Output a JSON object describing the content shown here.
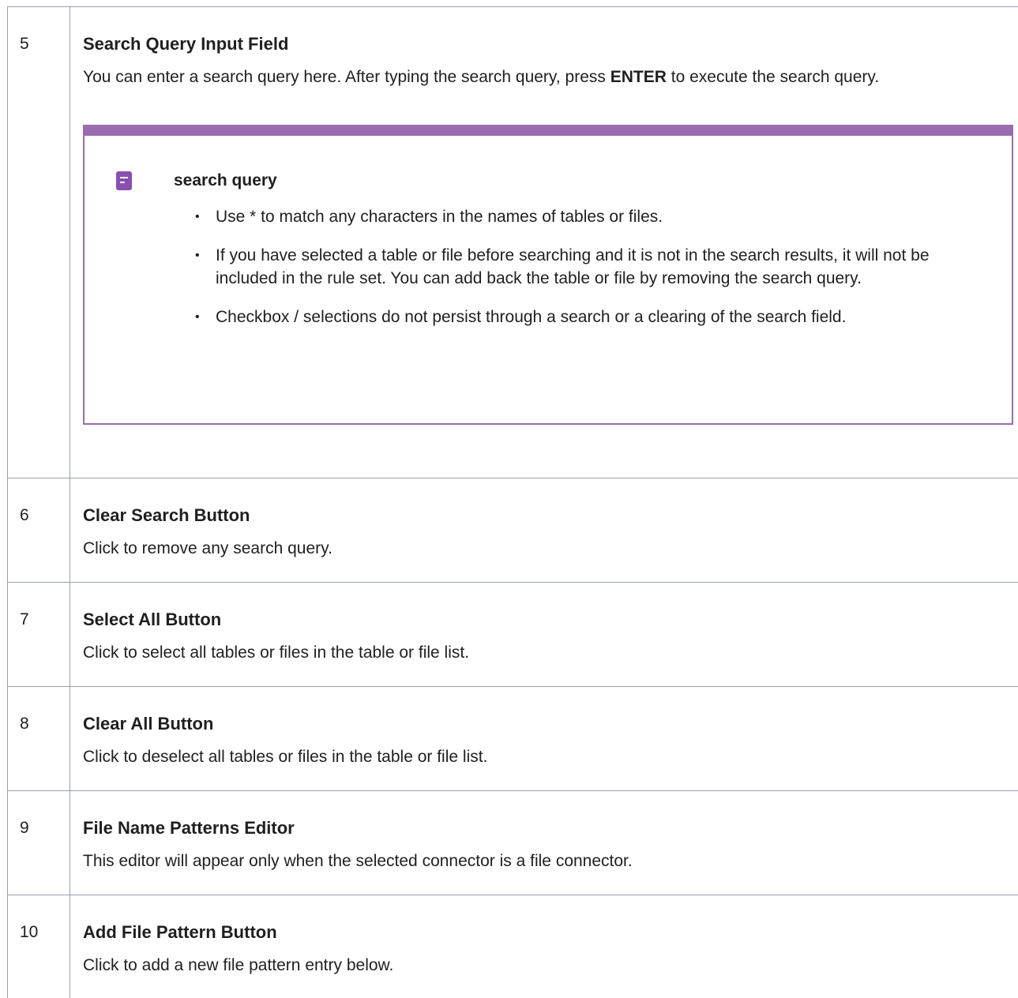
{
  "rows": [
    {
      "number": "5",
      "title": "Search Query Input Field",
      "desc_before": "You can enter a search query here. After typing the search query, press ",
      "desc_bold": "ENTER",
      "desc_after": " to execute the search query.",
      "note": {
        "title": "search query",
        "icon": "note-icon",
        "items": [
          "Use * to match any characters in the names of tables or files.",
          "If you have selected a table or file before searching and it is not in the search results, it will not be included in the rule set. You can add back the table or file by removing the search query.",
          "Checkbox / selections do not persist through a search or a clearing of the search field."
        ]
      }
    },
    {
      "number": "6",
      "title": "Clear Search Button",
      "desc": "Click to remove any search query."
    },
    {
      "number": "7",
      "title": "Select All Button",
      "desc": "Click to select all tables or files in the table or file list."
    },
    {
      "number": "8",
      "title": "Clear All Button",
      "desc": "Click to deselect all tables or files in the table or file list."
    },
    {
      "number": "9",
      "title": "File Name Patterns Editor",
      "desc": "This editor will appear only when the selected connector is a file connector."
    },
    {
      "number": "10",
      "title": "Add File Pattern Button",
      "desc": "Click to add a new file pattern entry below."
    }
  ],
  "colors": {
    "note_accent": "#9b6bb0",
    "border": "#9aa0a6"
  }
}
